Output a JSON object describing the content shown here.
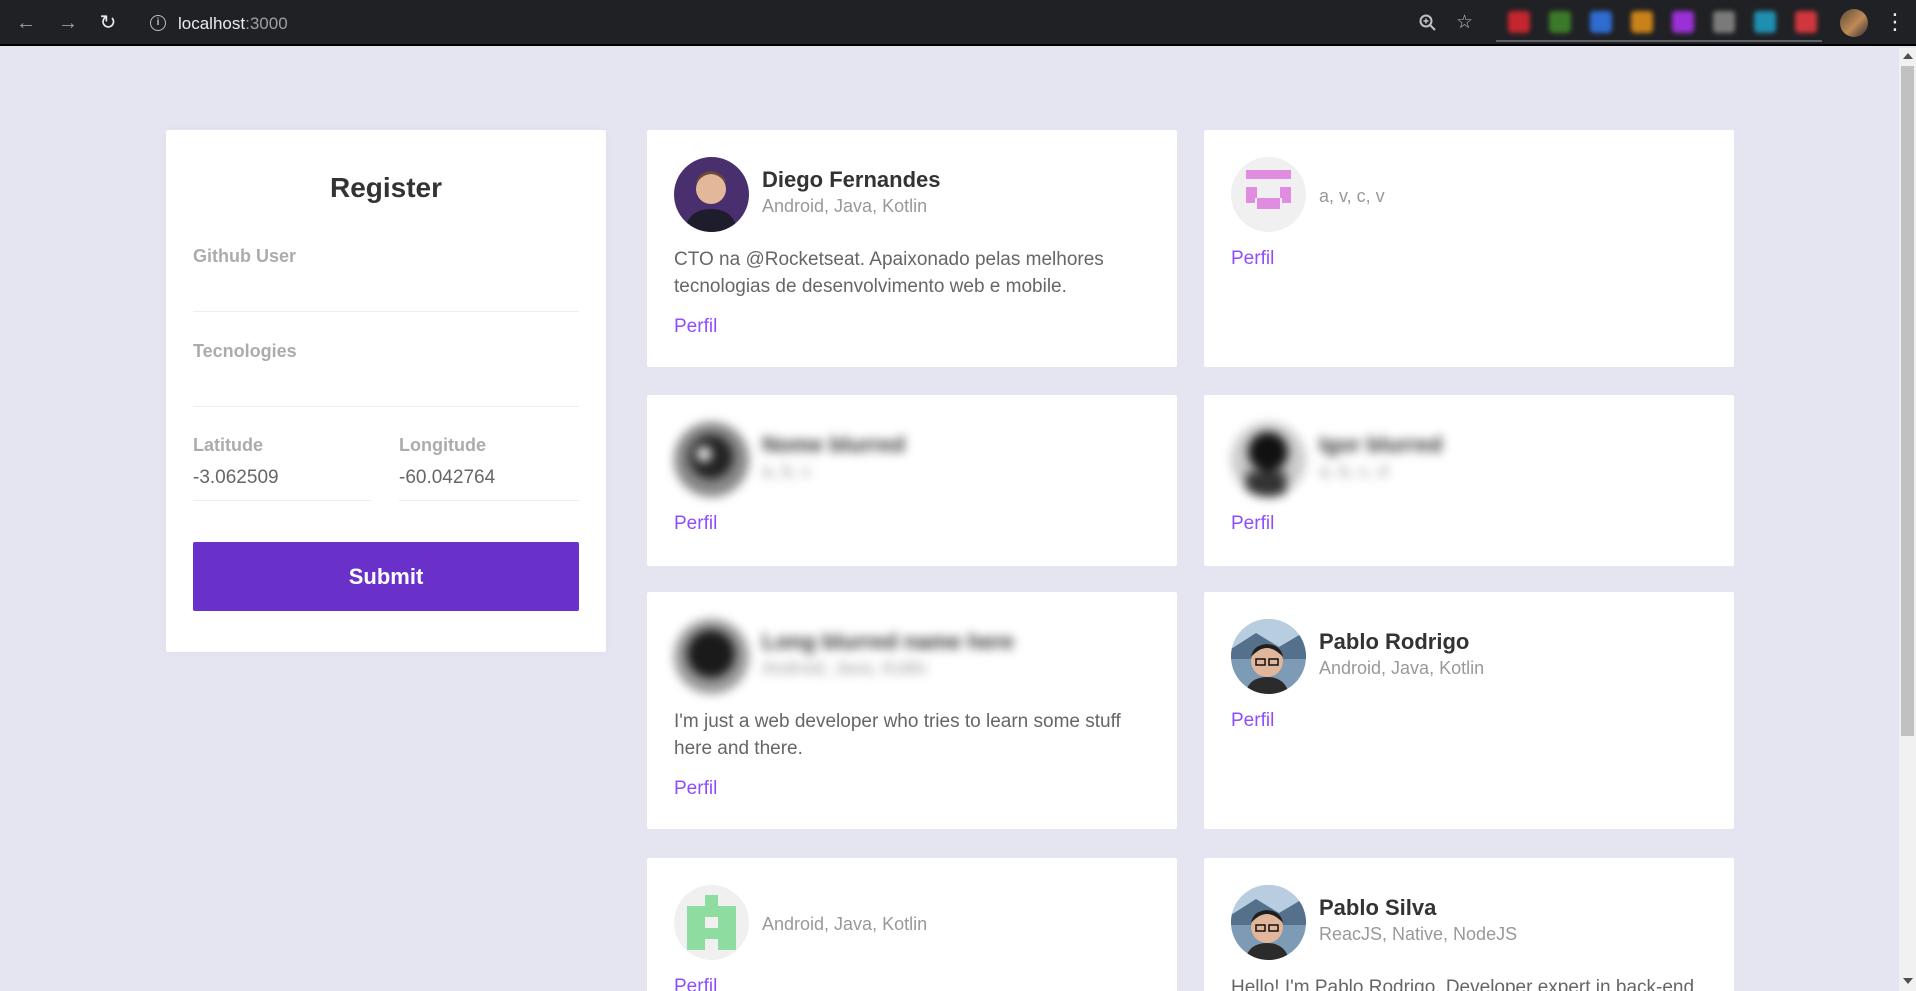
{
  "browser": {
    "url_host": "localhost",
    "url_port": ":3000",
    "extension_colors": [
      "#c4262e",
      "#3b7a2a",
      "#2f6bd1",
      "#c8821a",
      "#9a30d6",
      "#7a7a7a",
      "#1f8fb0",
      "#d0363e"
    ]
  },
  "register": {
    "title": "Register",
    "github_user_label": "Github User",
    "github_user_value": "",
    "techs_label": "Tecnologies",
    "techs_value": "",
    "latitude_label": "Latitude",
    "latitude_value": "-3.062509",
    "longitude_label": "Longitude",
    "longitude_value": "-60.042764",
    "submit_label": "Submit"
  },
  "devs": [
    {
      "name": "Diego Fernandes",
      "techs": "Android, Java, Kotlin",
      "bio": "CTO na @Rocketseat. Apaixonado pelas melhores tecnologias de desenvolvimento web e mobile.",
      "link": "Perfil"
    },
    {
      "name": "",
      "techs": "a, v, c, v",
      "bio": "",
      "link": "Perfil"
    },
    {
      "name": "Nome blurred",
      "techs": "a, b, c",
      "bio": "",
      "link": "Perfil"
    },
    {
      "name": "Igor blurred",
      "techs": "a, b, c, d",
      "bio": "",
      "link": "Perfil"
    },
    {
      "name": "Long blurred name here",
      "techs": "Android, Java, Kotlin",
      "bio": "I'm just a web developer who tries to learn some stuff here and there.",
      "link": "Perfil"
    },
    {
      "name": "Pablo Rodrigo",
      "techs": "Android, Java, Kotlin",
      "bio": "",
      "link": "Perfil"
    },
    {
      "name": "",
      "techs": "Android, Java, Kotlin",
      "bio": "",
      "link": "Perfil"
    },
    {
      "name": "Pablo Silva",
      "techs": "ReacJS, Native, NodeJS",
      "bio": "Hello! I'm Pablo Rodrigo, Developer expert in back-end",
      "link": "Perfil"
    }
  ]
}
